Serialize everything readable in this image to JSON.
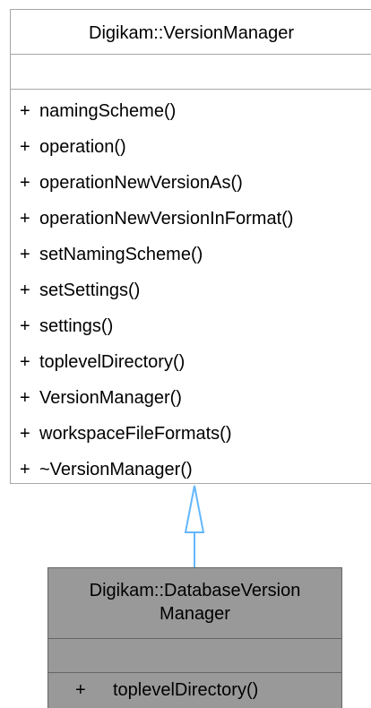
{
  "base_class": {
    "name": "Digikam::VersionManager",
    "methods": [
      {
        "visibility": "+",
        "name": "namingScheme()"
      },
      {
        "visibility": "+",
        "name": "operation()"
      },
      {
        "visibility": "+",
        "name": "operationNewVersionAs()"
      },
      {
        "visibility": "+",
        "name": "operationNewVersionInFormat()"
      },
      {
        "visibility": "+",
        "name": "setNamingScheme()"
      },
      {
        "visibility": "+",
        "name": "setSettings()"
      },
      {
        "visibility": "+",
        "name": "settings()"
      },
      {
        "visibility": "+",
        "name": "toplevelDirectory()"
      },
      {
        "visibility": "+",
        "name": "VersionManager()"
      },
      {
        "visibility": "+",
        "name": "workspaceFileFormats()"
      },
      {
        "visibility": "+",
        "name": "~VersionManager()"
      }
    ]
  },
  "derived_class": {
    "name_line1": "Digikam::DatabaseVersion",
    "name_line2": "Manager",
    "methods": [
      {
        "visibility": "+",
        "name": "toplevelDirectory()"
      }
    ]
  },
  "colors": {
    "box_border": "#a6a6a6",
    "derived_fill": "#999999",
    "derived_border": "#666666",
    "arrow": "#63b8ff"
  }
}
